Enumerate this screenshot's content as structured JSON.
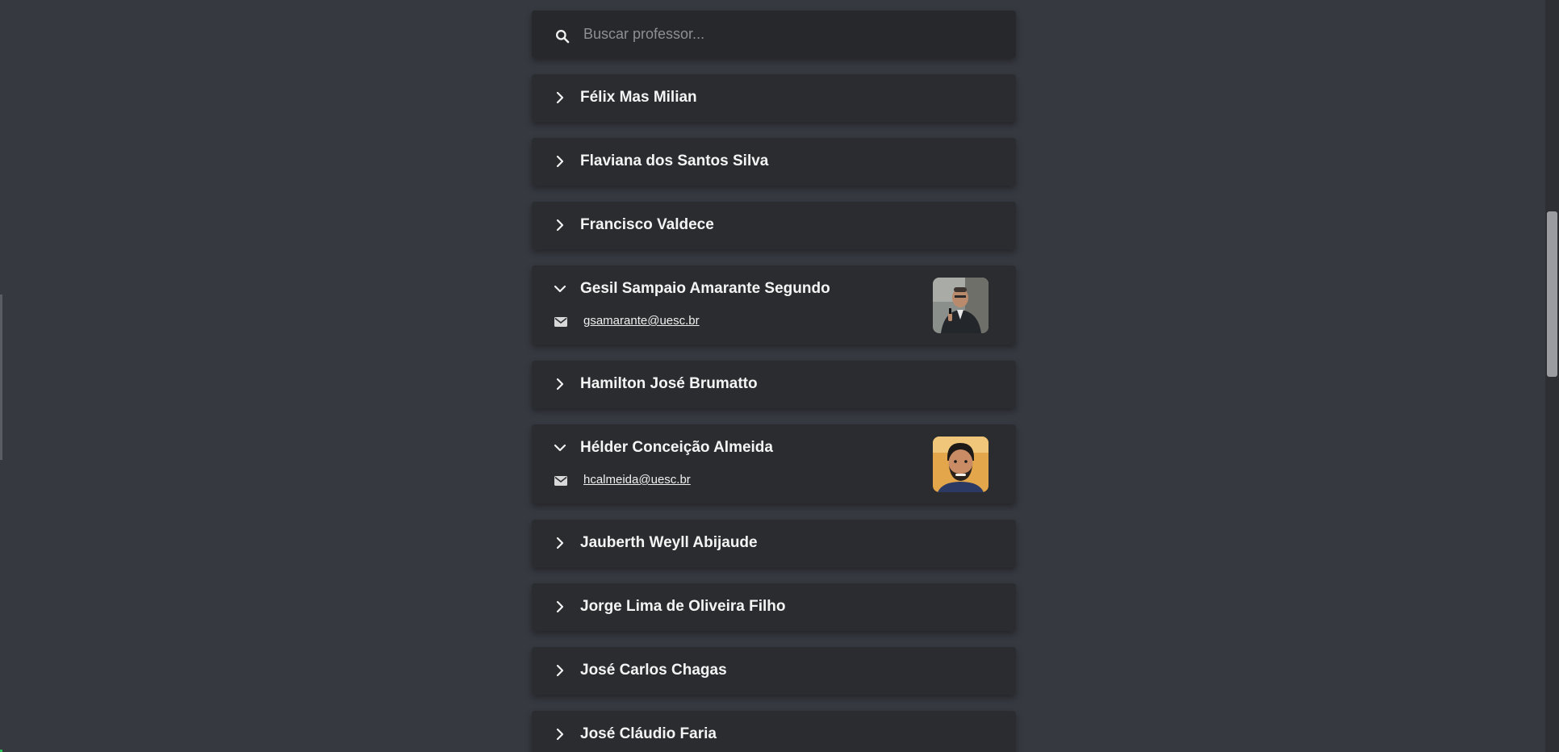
{
  "search": {
    "placeholder": "Buscar professor...",
    "icon": "search-icon"
  },
  "professors": [
    {
      "name": "Félix Mas Milian",
      "expanded": false
    },
    {
      "name": "Flaviana dos Santos Silva",
      "expanded": false
    },
    {
      "name": "Francisco Valdece",
      "expanded": false
    },
    {
      "name": "Gesil Sampaio Amarante Segundo",
      "expanded": true,
      "email": "gsamarante@uesc.br"
    },
    {
      "name": "Hamilton José Brumatto",
      "expanded": false
    },
    {
      "name": "Hélder Conceição Almeida",
      "expanded": true,
      "email": "hcalmeida@uesc.br"
    },
    {
      "name": "Jauberth Weyll Abijaude",
      "expanded": false
    },
    {
      "name": "Jorge Lima de Oliveira Filho",
      "expanded": false
    },
    {
      "name": "José Carlos Chagas",
      "expanded": false
    },
    {
      "name": "José Cláudio Faria",
      "expanded": false
    }
  ],
  "colors": {
    "background": "#363940",
    "card": "#2b2c30",
    "search": "#27282c",
    "text": "#f4f4f4",
    "placeholder": "#8e8f93"
  }
}
